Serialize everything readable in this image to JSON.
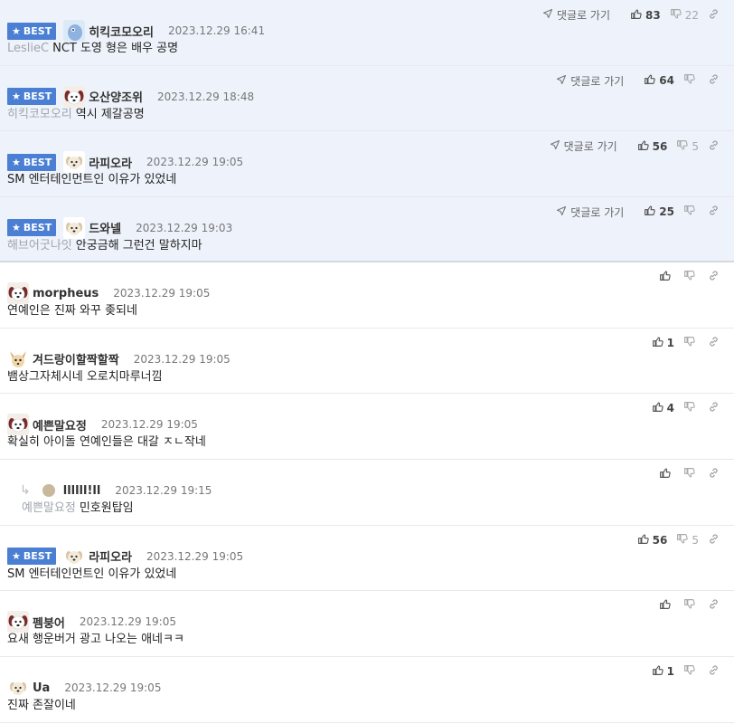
{
  "labels": {
    "best": "BEST",
    "goto_reply": "댓글로 가기"
  },
  "colors": {
    "best_bg": "#eef3fb",
    "best_badge": "#4a7fd4",
    "tag_text": "#a0a6ae"
  },
  "comments": [
    {
      "best": true,
      "nick": "히킥코모오리",
      "date": "2023.12.29 16:41",
      "tag": "LeslieC",
      "text": "NCT 도영 형은 배우 공명",
      "goto": true,
      "up": "83",
      "down": "22",
      "avatar": "blue-bird-avatar"
    },
    {
      "best": true,
      "nick": "오산양조위",
      "date": "2023.12.29 18:48",
      "tag": "히킥코모오리",
      "text": "역시 제갈공명",
      "goto": true,
      "up": "64",
      "down": "",
      "avatar": "dog-avatar"
    },
    {
      "best": true,
      "nick": "라피오라",
      "date": "2023.12.29 19:05",
      "tag": "",
      "text": "SM 엔터테인먼트인 이유가 있었네",
      "goto": true,
      "up": "56",
      "down": "5",
      "avatar": "puppy-avatar"
    },
    {
      "best": true,
      "nick": "드와넬",
      "date": "2023.12.29 19:03",
      "tag": "해브어굿나잇",
      "text": "안궁금해 그런건 말하지마",
      "goto": true,
      "up": "25",
      "down": "",
      "avatar": "puppy-avatar"
    },
    {
      "best": false,
      "nick": "morpheus",
      "date": "2023.12.29 19:05",
      "tag": "",
      "text": "연예인은 진짜 와꾸 좆되네",
      "goto": false,
      "up": "",
      "down": "",
      "avatar": "dog-avatar"
    },
    {
      "best": false,
      "nick": "겨드랑이할짝할짝",
      "date": "2023.12.29 19:05",
      "tag": "",
      "text": "뱀상그자체시네 오로치마루너낌",
      "goto": false,
      "up": "1",
      "down": "",
      "avatar": "chihuahua-avatar"
    },
    {
      "best": false,
      "nick": "예쁜말요정",
      "date": "2023.12.29 19:05",
      "tag": "",
      "text": "확실히 아이돌 연예인들은 대갈 ㅈㄴ작네",
      "goto": false,
      "up": "4",
      "down": "",
      "avatar": "dog-avatar"
    },
    {
      "best": false,
      "reply": true,
      "nick": "llllll!ll",
      "date": "2023.12.29 19:15",
      "tag": "예쁜말요정",
      "text": "민호원탑임",
      "goto": false,
      "up": "",
      "down": "",
      "avatar": "default-avatar"
    },
    {
      "best": true,
      "nick": "라피오라",
      "date": "2023.12.29 19:05",
      "tag": "",
      "text": "SM 엔터테인먼트인 이유가 있었네",
      "goto": false,
      "up": "56",
      "down": "5",
      "avatar": "puppy-avatar",
      "white": true
    },
    {
      "best": false,
      "nick": "펨붕어",
      "date": "2023.12.29 19:05",
      "tag": "",
      "text": "요새 행운버거 광고 나오는 애네ㅋㅋ",
      "goto": false,
      "up": "",
      "down": "",
      "avatar": "dog-avatar"
    },
    {
      "best": false,
      "nick": "Ua",
      "date": "2023.12.29 19:05",
      "tag": "",
      "text": "진짜 존잘이네",
      "goto": false,
      "up": "1",
      "down": "",
      "avatar": "puppy-avatar"
    }
  ]
}
